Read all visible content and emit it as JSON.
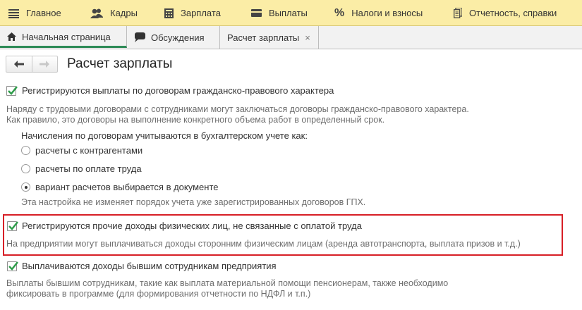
{
  "topbar": {
    "sections": [
      {
        "label": "Главное",
        "icon": "menu-icon"
      },
      {
        "label": "Кадры",
        "icon": "people-icon"
      },
      {
        "label": "Зарплата",
        "icon": "calculator-icon"
      },
      {
        "label": "Выплаты",
        "icon": "card-icon"
      },
      {
        "label": "Налоги и взносы",
        "icon": "percent-icon"
      },
      {
        "label": "Отчетность, справки",
        "icon": "reports-icon"
      }
    ]
  },
  "tabs": [
    {
      "label": "Начальная страница",
      "icon": "home-icon"
    },
    {
      "label": "Обсуждения",
      "icon": "chat-icon"
    },
    {
      "label": "Расчет зарплаты",
      "close": "×"
    }
  ],
  "page": {
    "title": "Расчет зарплаты"
  },
  "settings": {
    "gph": {
      "label": "Регистрируются выплаты по договорам гражданско-правового характера",
      "checked": true,
      "desc1": "Наряду с трудовыми договорами с сотрудниками могут заключаться договоры гражданско-правового характера.",
      "desc2": "Как правило, это договоры на выполнение конкретного объема работ в определенный срок.",
      "accounting_label": "Начисления по договорам учитываются в бухгалтерском учете как:",
      "options": [
        "расчеты с контрагентами",
        "расчеты по оплате труда",
        "вариант расчетов выбирается в документе"
      ],
      "selected": 2,
      "note": "Эта настройка не изменяет порядок учета уже зарегистрированных договоров ГПХ."
    },
    "other_income": {
      "label": "Регистрируются прочие доходы физических лиц, не связанные с оплатой труда",
      "checked": true,
      "desc": "На предприятии могут выплачиваться доходы сторонним физическим лицам (аренда автотранспорта, выплата призов и т.д.)"
    },
    "former": {
      "label": "Выплачиваются доходы бывшим сотрудникам предприятия",
      "checked": true,
      "desc1": "Выплаты бывшим сотрудникам, такие как выплата материальной помощи пенсионерам, также необходимо",
      "desc2": "фиксировать в программе (для формирования отчетности по НДФЛ и т.п.)"
    }
  },
  "colors": {
    "topbar": "#fbeda6",
    "active_tab": "#2e8b57",
    "highlight": "#d71f26",
    "check": "#2e9d4a"
  }
}
